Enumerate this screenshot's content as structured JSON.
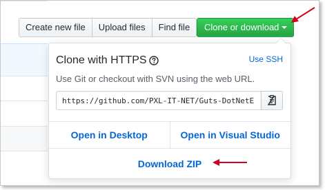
{
  "toolbar": {
    "create_label": "Create new file",
    "upload_label": "Upload files",
    "find_label": "Find file",
    "clone_label": "Clone or download"
  },
  "clone_panel": {
    "title": "Clone with HTTPS",
    "use_ssh_label": "Use SSH",
    "subtitle": "Use Git or checkout with SVN using the web URL.",
    "url": "https://github.com/PXL-IT-NET/Guts-DotNetE",
    "open_desktop_label": "Open in Desktop",
    "open_vs_label": "Open in Visual Studio",
    "download_zip_label": "Download ZIP"
  },
  "colors": {
    "link": "#0366d6",
    "green_button": "#28a745",
    "annotation_arrow": "#d0021b"
  },
  "icons": {
    "help": "question-circle-icon",
    "copy": "clipboard-icon",
    "caret": "triangle-down-icon",
    "annotation": "red-arrow-icon"
  }
}
